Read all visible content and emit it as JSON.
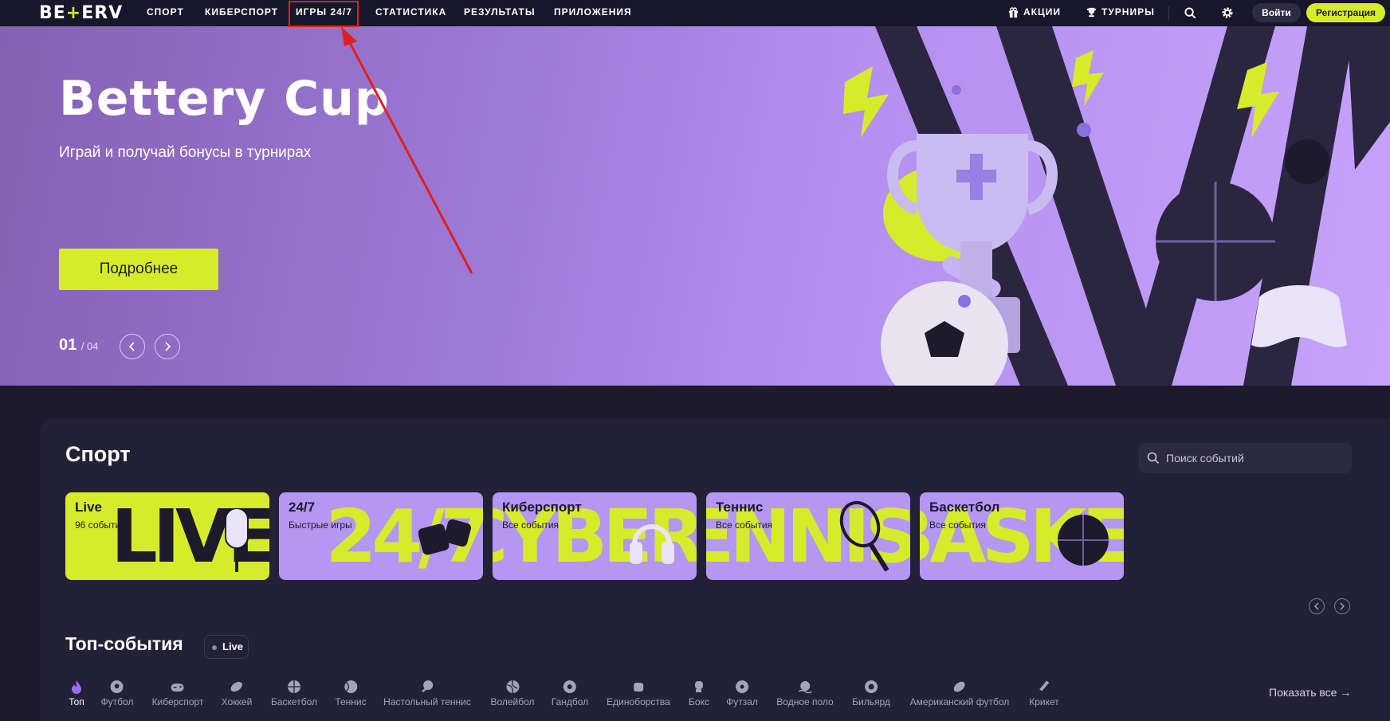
{
  "brand": {
    "logo_left": "BE",
    "logo_plus": "+",
    "logo_right": "ERV",
    "accent": "#d6ec2a",
    "purple": "#b596f2",
    "bg": "#1c1a2b"
  },
  "nav": {
    "items": [
      "Спорт",
      "Киберспорт",
      "Игры 24/7",
      "Статистика",
      "Результаты",
      "Приложения"
    ],
    "promo": "Акции",
    "tournaments": "Турниры",
    "login": "Войти",
    "register": "Регистрация"
  },
  "hero": {
    "title": "Bettery Cup",
    "subtitle": "Играй и получай бонусы в турнирах",
    "button": "Подробнее",
    "current": "01",
    "total": "/ 04"
  },
  "sport": {
    "title": "Спорт",
    "search_placeholder": "Поиск событий",
    "cards": [
      {
        "title": "Live",
        "sub": "96 событий",
        "big": "LIVE"
      },
      {
        "title": "24/7",
        "sub": "Быстрые игры",
        "big": "24/7"
      },
      {
        "title": "Киберспорт",
        "sub": "Все события",
        "big": "CYBER"
      },
      {
        "title": "Теннис",
        "sub": "Все события",
        "big": "TENNIS"
      },
      {
        "title": "Баскетбол",
        "sub": "Все события",
        "big": "BASKE"
      }
    ]
  },
  "top_events": {
    "title": "Топ-события",
    "live_label": "Live",
    "show_all": "Показать все →",
    "sports": [
      "Топ",
      "Футбол",
      "Киберспорт",
      "Хоккей",
      "Баскетбол",
      "Теннис",
      "Настольный теннис",
      "Волейбол",
      "Гандбол",
      "Единоборства",
      "Бокс",
      "Футзал",
      "Водное поло",
      "Бильярд",
      "Американский футбол",
      "Крикет"
    ]
  }
}
